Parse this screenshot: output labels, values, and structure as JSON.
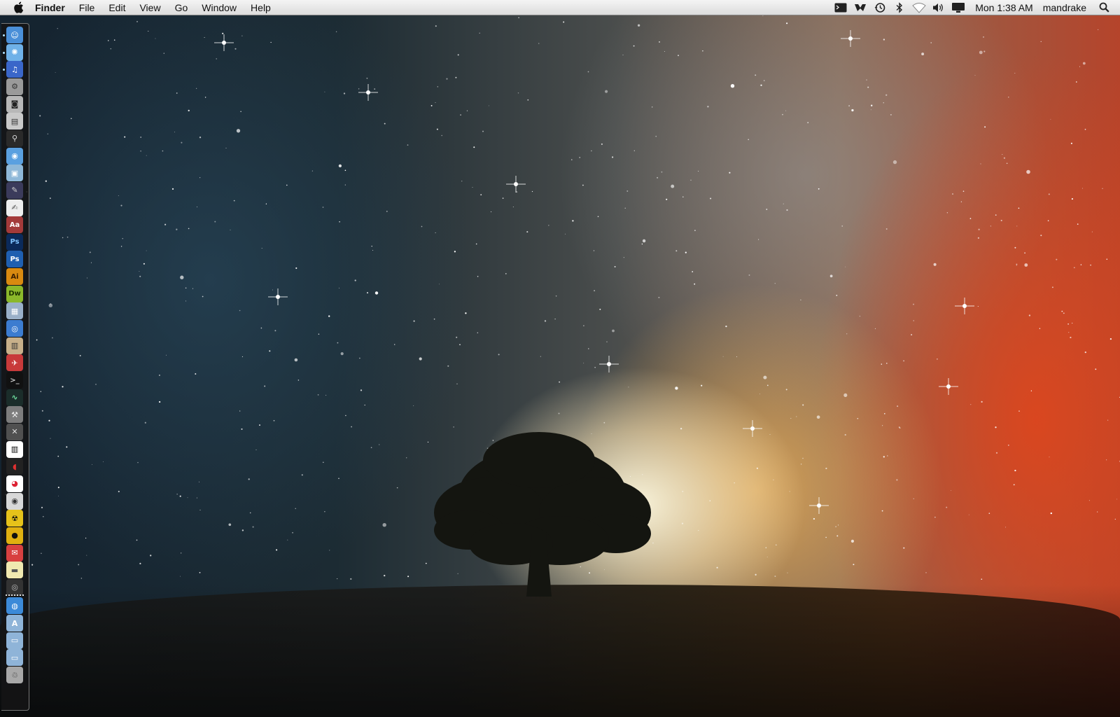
{
  "menubar": {
    "app_name": "Finder",
    "menus": [
      "File",
      "Edit",
      "View",
      "Go",
      "Window",
      "Help"
    ],
    "clock": "Mon 1:38 AM",
    "user": "mandrake",
    "status_icons": [
      "terminal-icon",
      "wingman-icon",
      "time-machine-icon",
      "bluetooth-icon",
      "wifi-icon",
      "volume-icon",
      "display-icon"
    ]
  },
  "dock": {
    "items": [
      {
        "name": "finder-icon",
        "bg": "#4a8fd8",
        "fg": "#fff",
        "glyph": "☺",
        "running": true
      },
      {
        "name": "safari-icon",
        "bg": "#6fb1e8",
        "fg": "#fff",
        "glyph": "✺",
        "running": true
      },
      {
        "name": "itunes-icon",
        "bg": "#3a66c9",
        "fg": "#fff",
        "glyph": "♫",
        "running": true
      },
      {
        "name": "system-preferences-icon",
        "bg": "#9a9a9a",
        "fg": "#333",
        "glyph": "⚙",
        "running": false
      },
      {
        "name": "photo-booth-icon",
        "bg": "#b8b8b8",
        "fg": "#222",
        "glyph": "◙",
        "running": false
      },
      {
        "name": "preview-icon",
        "bg": "#c9c9c9",
        "fg": "#333",
        "glyph": "▤",
        "running": false
      },
      {
        "name": "automator-icon",
        "bg": "#2a2a2a",
        "fg": "#ddd",
        "glyph": "⚲",
        "running": false
      },
      {
        "name": "ichat-icon",
        "bg": "#5aa0e0",
        "fg": "#fff",
        "glyph": "◉",
        "running": false
      },
      {
        "name": "iphoto-icon",
        "bg": "#8fb8d8",
        "fg": "#fff",
        "glyph": "▣",
        "running": false
      },
      {
        "name": "pen-tool-icon",
        "bg": "#3b3b5b",
        "fg": "#ccc",
        "glyph": "✎",
        "running": false
      },
      {
        "name": "textedit-icon",
        "bg": "#eeeeee",
        "fg": "#555",
        "glyph": "✍",
        "running": false
      },
      {
        "name": "dictionary-icon",
        "bg": "#a33a3a",
        "fg": "#fff",
        "glyph": "Aa",
        "running": false
      },
      {
        "name": "photoshop-icon",
        "bg": "#0b2a5a",
        "fg": "#7fc3ff",
        "glyph": "Ps",
        "running": false
      },
      {
        "name": "photoshop-alt-icon",
        "bg": "#1f5fb0",
        "fg": "#ffffff",
        "glyph": "Ps",
        "running": false
      },
      {
        "name": "illustrator-icon",
        "bg": "#d98a10",
        "fg": "#3a1e00",
        "glyph": "Ai",
        "running": false
      },
      {
        "name": "dreamweaver-icon",
        "bg": "#8bb82a",
        "fg": "#1e3300",
        "glyph": "Dw",
        "running": false
      },
      {
        "name": "image-capture-icon",
        "bg": "#9ab0c8",
        "fg": "#fff",
        "glyph": "▦",
        "running": false
      },
      {
        "name": "quicktime-icon",
        "bg": "#3c7cd0",
        "fg": "#fff",
        "glyph": "◎",
        "running": false
      },
      {
        "name": "iwork-icon",
        "bg": "#c8b08a",
        "fg": "#333",
        "glyph": "▥",
        "running": false
      },
      {
        "name": "web-browser-icon",
        "bg": "#c83a3a",
        "fg": "#fff",
        "glyph": "✈",
        "running": false
      },
      {
        "name": "terminal-icon",
        "bg": "#111111",
        "fg": "#ccc",
        "glyph": ">_",
        "running": false
      },
      {
        "name": "activity-monitor-icon",
        "bg": "#1b2d2a",
        "fg": "#6fe0a0",
        "glyph": "∿",
        "running": false
      },
      {
        "name": "instruments-icon",
        "bg": "#7d7d7d",
        "fg": "#eee",
        "glyph": "⚒",
        "running": false
      },
      {
        "name": "x11-icon",
        "bg": "#505050",
        "fg": "#ddd",
        "glyph": "✕",
        "running": false
      },
      {
        "name": "piano-icon",
        "bg": "#ffffff",
        "fg": "#000",
        "glyph": "▥",
        "running": false
      },
      {
        "name": "red-app-icon",
        "bg": "#222",
        "fg": "#e03030",
        "glyph": "◖",
        "running": false
      },
      {
        "name": "chrome-icon",
        "bg": "#ffffff",
        "fg": "#d23",
        "glyph": "◕",
        "running": false
      },
      {
        "name": "dvd-player-icon",
        "bg": "#d8d8d8",
        "fg": "#333",
        "glyph": "◉",
        "running": false
      },
      {
        "name": "radioactive-app-icon",
        "bg": "#e6c21a",
        "fg": "#111",
        "glyph": "☢",
        "running": false
      },
      {
        "name": "camino-icon",
        "bg": "#e0b010",
        "fg": "#111",
        "glyph": "●",
        "running": false
      },
      {
        "name": "adium-icon",
        "bg": "#d84040",
        "fg": "#fff",
        "glyph": "✉",
        "running": false
      },
      {
        "name": "document-icon",
        "bg": "#f0e8b0",
        "fg": "#555",
        "glyph": "▬",
        "running": false
      },
      {
        "name": "camera-app-icon",
        "bg": "#333",
        "fg": "#bbb",
        "glyph": "◎",
        "running": false
      },
      {
        "name": "network-globe-icon",
        "bg": "#3c8ad8",
        "fg": "#fff",
        "glyph": "◍",
        "running": false
      },
      {
        "name": "applications-folder-icon",
        "bg": "#8fb4d8",
        "fg": "#fff",
        "glyph": "A",
        "running": false
      },
      {
        "name": "documents-folder-icon",
        "bg": "#8fb4d8",
        "fg": "#fff",
        "glyph": "▭",
        "running": false
      },
      {
        "name": "downloads-folder-icon",
        "bg": "#8fb4d8",
        "fg": "#fff",
        "glyph": "▭",
        "running": false
      },
      {
        "name": "trash-icon",
        "bg": "#a8a8a8",
        "fg": "#444",
        "glyph": "♲",
        "running": false
      }
    ]
  }
}
